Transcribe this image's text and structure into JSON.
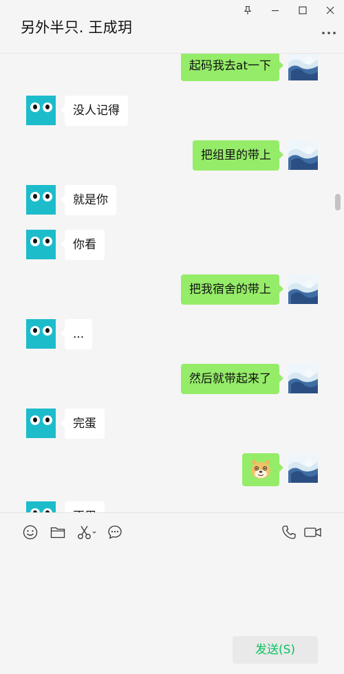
{
  "header": {
    "title": "另外半只. 王成玥",
    "controls": [
      "pin-icon",
      "minimize-icon",
      "maximize-icon",
      "close-icon"
    ],
    "more": "more-icon"
  },
  "messages": [
    {
      "side": "out",
      "text": "起码我去at一下"
    },
    {
      "side": "in",
      "text": "没人记得"
    },
    {
      "side": "out",
      "text": "把组里的带上"
    },
    {
      "side": "in",
      "text": "就是你"
    },
    {
      "side": "in",
      "text": "你看"
    },
    {
      "side": "out",
      "text": "把我宿舍的带上"
    },
    {
      "side": "in",
      "text": "..."
    },
    {
      "side": "out",
      "text": "然后就带起来了"
    },
    {
      "side": "in",
      "text": "完蛋"
    },
    {
      "side": "out",
      "text": "",
      "emoji": "doge-emoji"
    },
    {
      "side": "in",
      "text": "不用"
    }
  ],
  "toolbar": {
    "left": [
      "emoji-icon",
      "folder-icon",
      "scissors-icon",
      "chat-history-icon"
    ],
    "right": [
      "phone-icon",
      "video-icon"
    ]
  },
  "input": {
    "value": ""
  },
  "send": {
    "label": "发送(S)"
  },
  "colors": {
    "background": "#f5f5f5",
    "outgoing_bubble": "#95ec69",
    "incoming_bubble": "#ffffff",
    "friend_avatar": "#1dbccb",
    "send_text": "#07c160"
  }
}
